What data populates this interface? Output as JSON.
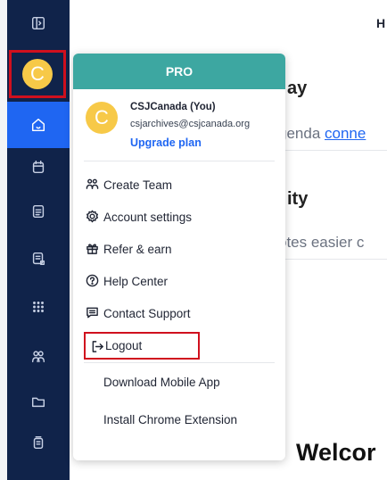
{
  "sidebar": {
    "collapse_icon": "panel-toggle-icon",
    "avatar_initial": "C",
    "items": [
      {
        "icon": "home-icon",
        "active": true
      },
      {
        "icon": "calendar-icon",
        "active": false
      },
      {
        "icon": "document-icon",
        "active": false
      },
      {
        "icon": "notes-list-icon",
        "active": false
      },
      {
        "icon": "grid-dots-icon",
        "active": false
      },
      {
        "icon": "team-icon",
        "active": false
      },
      {
        "icon": "folder-icon",
        "active": false
      },
      {
        "icon": "stack-icon",
        "active": false
      }
    ]
  },
  "background": {
    "header_letter": "H",
    "section1_title": "ay",
    "section1_text": "genda ",
    "section1_link": "conne",
    "section2_title": "ity",
    "section2_text": "otes easier c",
    "welcome": "Welcor"
  },
  "menu": {
    "plan": "PRO",
    "avatar_initial": "C",
    "user_name": "CSJCanada (You)",
    "email": "csjarchives@csjcanada.org",
    "upgrade": "Upgrade plan",
    "items": [
      {
        "label": "Create Team",
        "icon": "people-icon"
      },
      {
        "label": "Account settings",
        "icon": "gear-icon"
      },
      {
        "label": "Refer & earn",
        "icon": "gift-icon"
      },
      {
        "label": "Help Center",
        "icon": "help-icon"
      },
      {
        "label": "Contact Support",
        "icon": "chat-icon"
      },
      {
        "label": "Logout",
        "icon": "logout-icon"
      }
    ],
    "download_app": "Download Mobile App",
    "install_extension": "Install Chrome Extension"
  },
  "colors": {
    "rail": "#10234a",
    "active": "#1f66f2",
    "header": "#3da7a1",
    "highlight": "#d0101e",
    "avatar": "#f7c948"
  }
}
